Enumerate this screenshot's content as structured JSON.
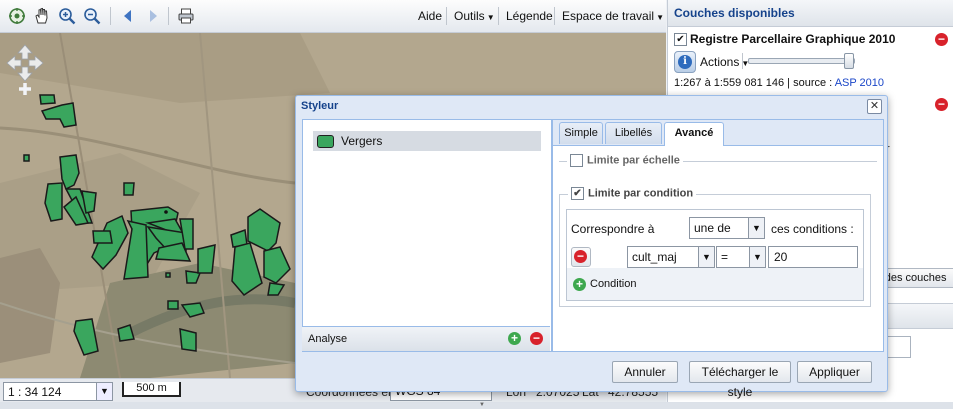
{
  "toolbar": {
    "icons": [
      "zoom-extent-icon",
      "pan-hand-icon",
      "zoom-in-icon",
      "zoom-out-icon",
      "back-icon",
      "forward-icon",
      "print-icon"
    ],
    "menu": {
      "help": "Aide",
      "tools": "Outils",
      "legend": "Légende",
      "workspace": "Espace de travail"
    }
  },
  "map": {
    "scale_value": "1 : 34 124",
    "scalebar_label": "500 m",
    "coords_label": "Coordonnées en",
    "projection": "WGS 84",
    "lon_label": "Lon",
    "lon_value": "2.07025",
    "lat_label": "Lat",
    "lat_value": "42.78555",
    "parcel_color": "#3aa65e"
  },
  "right_panel": {
    "title": "Couches disponibles",
    "layer": {
      "name": "Registre Parcellaire Graphique 2010",
      "checked": true,
      "actions_label": "Actions",
      "scale_range": "1:267 à 1:559 081 146",
      "source_prefix": "source :",
      "source": "ASP 2010"
    },
    "partial_texts": {
      "line": "r",
      "add_layers": "r des couches"
    }
  },
  "styler": {
    "title": "Styleur",
    "rule": {
      "label": "Vergers",
      "color": "#3aa65e"
    },
    "analyse_label": "Analyse",
    "tabs": [
      "Simple",
      "Libellés",
      "Avancé"
    ],
    "active_tab": "Avancé",
    "scale_limit": {
      "label": "Limite par échelle",
      "checked": false
    },
    "condition_limit": {
      "label": "Limite par condition",
      "checked": true
    },
    "match_label": "Correspondre à",
    "match_value": "une de",
    "match_suffix": "ces conditions :",
    "condition": {
      "field": "cult_maj",
      "operator": "=",
      "value": "20"
    },
    "add_condition_label": "Condition",
    "buttons": {
      "cancel": "Annuler",
      "download": "Télécharger le style",
      "apply": "Appliquer"
    }
  }
}
